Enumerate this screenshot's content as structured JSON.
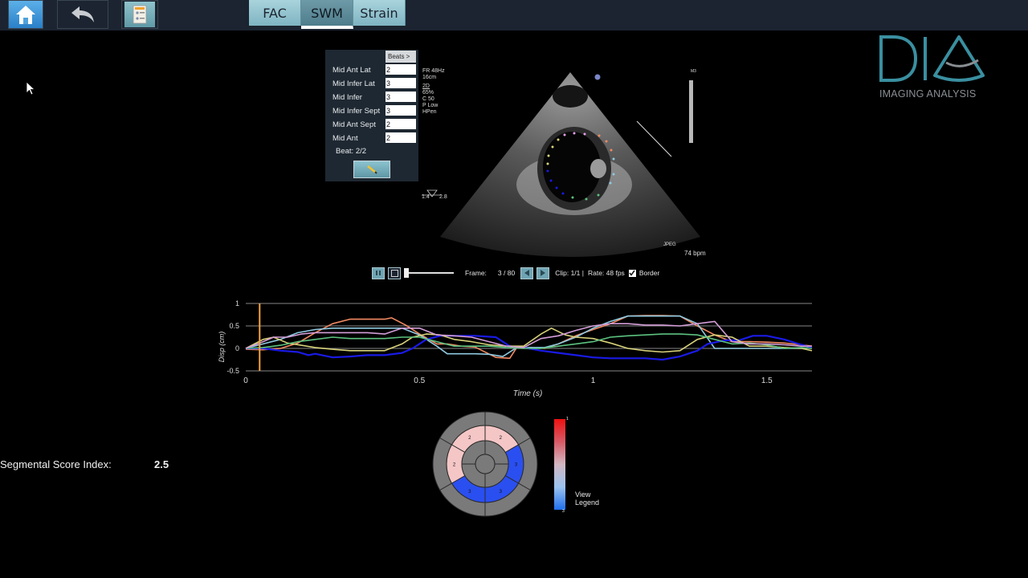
{
  "toolbar": {
    "home_icon": "home-icon",
    "back_icon": "undo-arrow-icon",
    "report_icon": "report-document-icon",
    "tabs": [
      {
        "label": "FAC",
        "active": false
      },
      {
        "label": "SWM",
        "active": true
      },
      {
        "label": "Strain",
        "active": false
      }
    ]
  },
  "logo": {
    "mark": "DIA",
    "subtitle": "IMAGING ANALYSIS"
  },
  "segment_panel": {
    "beats_button": "Beats >",
    "segments": [
      {
        "label": "Mid Ant Lat",
        "value": "2"
      },
      {
        "label": "Mid Infer Lat",
        "value": "3"
      },
      {
        "label": "Mid Infer",
        "value": "3"
      },
      {
        "label": "Mid Infer Sept",
        "value": "3"
      },
      {
        "label": "Mid Ant Sept",
        "value": "2"
      },
      {
        "label": "Mid Ant",
        "value": "2"
      }
    ],
    "beat_label": "Beat: 2/2",
    "edit_icon": "pencil-icon"
  },
  "echo_overlay": {
    "params": [
      "FR 48Hz",
      "16cm",
      "2D",
      "65%",
      "C 50",
      "P Low",
      "HPen"
    ],
    "probe": [
      "1.4",
      "2.8"
    ],
    "heart_rate": "74 bpm",
    "corner_tag": "M3",
    "bottom_tag": "JPEG"
  },
  "playback": {
    "frame_label": "Frame:",
    "frame_value": "3 / 80",
    "clip": "Clip: 1/1 |",
    "rate": "Rate: 48 fps",
    "border_label": "Border",
    "border_checked": true,
    "slider_position": 0.03
  },
  "chart_data": {
    "type": "line",
    "title": "",
    "xlabel": "Time (s)",
    "ylabel": "Disp (cm)",
    "xlim": [
      0,
      1.63
    ],
    "ylim": [
      -0.5,
      1
    ],
    "xticks": [
      "0",
      "0.5",
      "1",
      "1.5"
    ],
    "xtick_values": [
      0,
      0.5,
      1,
      1.5
    ],
    "yticks": [
      "1",
      "0.5",
      "0",
      "-0.5"
    ],
    "ytick_values": [
      1,
      0.5,
      0,
      -0.5
    ],
    "grid": true,
    "cursor_time": 0.04,
    "series": [
      {
        "name": "Mid Ant Lat",
        "color": "#f28a62",
        "x": [
          0,
          0.05,
          0.1,
          0.15,
          0.2,
          0.25,
          0.3,
          0.35,
          0.4,
          0.42,
          0.46,
          0.5,
          0.55,
          0.58,
          0.62,
          0.66,
          0.72,
          0.76,
          0.78,
          0.82,
          0.86,
          0.9,
          0.95,
          1,
          1.05,
          1.1,
          1.15,
          1.2,
          1.25,
          1.3,
          1.35,
          1.4,
          1.45,
          1.5,
          1.55,
          1.6,
          1.63
        ],
        "y": [
          -0.02,
          -0.03,
          0,
          0.12,
          0.35,
          0.55,
          0.65,
          0.65,
          0.65,
          0.68,
          0.52,
          0.32,
          0.1,
          0.1,
          0.05,
          0.03,
          -0.2,
          -0.22,
          0.02,
          0.02,
          0,
          0.1,
          0.28,
          0.42,
          0.55,
          0.72,
          0.73,
          0.73,
          0.72,
          0.5,
          0.3,
          0.15,
          0.15,
          0.14,
          0.12,
          0.08,
          0.05
        ]
      },
      {
        "name": "Mid Infer Lat",
        "color": "#8fc9e0",
        "x": [
          0,
          0.05,
          0.1,
          0.15,
          0.2,
          0.25,
          0.3,
          0.35,
          0.4,
          0.45,
          0.5,
          0.55,
          0.58,
          0.62,
          0.66,
          0.7,
          0.74,
          0.78,
          0.82,
          0.86,
          0.9,
          0.95,
          1,
          1.05,
          1.1,
          1.15,
          1.2,
          1.25,
          1.3,
          1.35,
          1.4,
          1.45,
          1.5,
          1.55,
          1.6,
          1.63
        ],
        "y": [
          0,
          0.1,
          0.2,
          0.35,
          0.42,
          0.45,
          0.45,
          0.45,
          0.45,
          0.45,
          0.3,
          0.05,
          -0.12,
          -0.12,
          -0.12,
          -0.13,
          -0.18,
          0.02,
          0.02,
          0.02,
          0.1,
          0.25,
          0.45,
          0.6,
          0.72,
          0.72,
          0.72,
          0.72,
          0.55,
          0,
          0,
          0,
          0,
          0,
          0,
          0.02
        ]
      },
      {
        "name": "Mid Infer",
        "color": "#1a1ae6",
        "x": [
          0,
          0.05,
          0.1,
          0.15,
          0.18,
          0.2,
          0.25,
          0.3,
          0.35,
          0.4,
          0.45,
          0.48,
          0.52,
          0.56,
          0.6,
          0.66,
          0.72,
          0.76,
          0.8,
          0.85,
          0.9,
          0.95,
          1,
          1.05,
          1.1,
          1.15,
          1.2,
          1.25,
          1.3,
          1.33,
          1.38,
          1.42,
          1.46,
          1.5,
          1.55,
          1.6,
          1.63
        ],
        "y": [
          0,
          0,
          -0.05,
          -0.08,
          -0.15,
          -0.12,
          -0.2,
          -0.18,
          -0.15,
          -0.15,
          -0.1,
          0,
          0.2,
          0.28,
          0.28,
          0.28,
          0.25,
          0.05,
          0.02,
          -0.05,
          -0.1,
          -0.15,
          -0.2,
          -0.22,
          -0.22,
          -0.22,
          -0.25,
          -0.18,
          -0.05,
          0.1,
          0.18,
          0.18,
          0.28,
          0.28,
          0.2,
          0.08,
          0.02
        ]
      },
      {
        "name": "Mid Infer Sept",
        "color": "#d8d27a",
        "x": [
          0,
          0.05,
          0.08,
          0.12,
          0.2,
          0.25,
          0.3,
          0.35,
          0.4,
          0.45,
          0.48,
          0.52,
          0.56,
          0.6,
          0.65,
          0.7,
          0.75,
          0.8,
          0.85,
          0.88,
          0.92,
          0.95,
          1,
          1.05,
          1.1,
          1.15,
          1.2,
          1.25,
          1.3,
          1.35,
          1.4,
          1.45,
          1.5,
          1.55,
          1.6,
          1.63
        ],
        "y": [
          0,
          0.2,
          0.25,
          0.12,
          0.02,
          -0.02,
          -0.05,
          -0.05,
          -0.05,
          0.1,
          0.25,
          0.32,
          0.3,
          0.2,
          0.15,
          0.08,
          0.05,
          0.05,
          0.32,
          0.45,
          0.3,
          0.25,
          0.22,
          0.12,
          0,
          -0.05,
          -0.08,
          -0.05,
          0.2,
          0.3,
          0.25,
          0.05,
          0.05,
          0.02,
          0,
          -0.05
        ]
      },
      {
        "name": "Mid Ant Sept",
        "color": "#5cc27f",
        "x": [
          0,
          0.05,
          0.1,
          0.15,
          0.2,
          0.25,
          0.3,
          0.35,
          0.4,
          0.45,
          0.5,
          0.55,
          0.6,
          0.65,
          0.7,
          0.75,
          0.8,
          0.85,
          0.9,
          0.95,
          1,
          1.05,
          1.1,
          1.15,
          1.2,
          1.25,
          1.3,
          1.35,
          1.4,
          1.45,
          1.5,
          1.55,
          1.6,
          1.63
        ],
        "y": [
          0,
          0.02,
          0.07,
          0.15,
          0.2,
          0.25,
          0.22,
          0.22,
          0.22,
          0.25,
          0.25,
          0.15,
          0.05,
          0.05,
          0.05,
          0.02,
          0,
          0,
          0.05,
          0.1,
          0.15,
          0.25,
          0.28,
          0.3,
          0.32,
          0.32,
          0.3,
          0.2,
          0.1,
          0.12,
          0.08,
          0,
          0.02,
          0
        ]
      },
      {
        "name": "Mid Ant",
        "color": "#d49ed8",
        "x": [
          0,
          0.05,
          0.08,
          0.12,
          0.16,
          0.2,
          0.25,
          0.3,
          0.35,
          0.4,
          0.45,
          0.5,
          0.55,
          0.6,
          0.65,
          0.7,
          0.75,
          0.8,
          0.85,
          0.9,
          0.95,
          1,
          1.05,
          1.1,
          1.15,
          1.2,
          1.25,
          1.3,
          1.35,
          1.4,
          1.45,
          1.5,
          1.55,
          1.6,
          1.63
        ],
        "y": [
          0,
          0.15,
          0.25,
          0.25,
          0.32,
          0.35,
          0.35,
          0.35,
          0.35,
          0.32,
          0.45,
          0.45,
          0.3,
          0.28,
          0.25,
          0.15,
          0.05,
          0.02,
          0.22,
          0.28,
          0.4,
          0.5,
          0.55,
          0.55,
          0.52,
          0.52,
          0.5,
          0.55,
          0.6,
          0.15,
          0.1,
          0.1,
          0.08,
          0.05,
          0.05
        ]
      }
    ]
  },
  "score": {
    "label": "Segmental Score Index:",
    "value": "2.5"
  },
  "bullseye": {
    "segments": [
      {
        "name": "Mid Ant",
        "score": "2",
        "color": "#f5c6c6"
      },
      {
        "name": "Mid Ant Lat",
        "score": "2",
        "color": "#f5c6c6"
      },
      {
        "name": "Mid Infer Lat",
        "score": "3",
        "color": "#2a4ff0"
      },
      {
        "name": "Mid Infer",
        "score": "3",
        "color": "#2a4ff0"
      },
      {
        "name": "Mid Infer Sept",
        "score": "3",
        "color": "#2a4ff0"
      },
      {
        "name": "Mid Ant Sept",
        "score": "2",
        "color": "#f5c6c6"
      }
    ],
    "legend_top": "1",
    "legend_bottom": "3",
    "legend_label_1": "View",
    "legend_label_2": "Legend"
  }
}
